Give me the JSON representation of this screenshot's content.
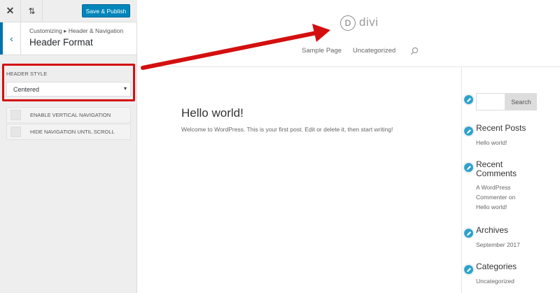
{
  "customizer": {
    "publish_label": "Save & Publish",
    "close_icon": "✕",
    "preview_icon": "⇅",
    "back_icon": "‹",
    "breadcrumb": "Customizing ▸ Header & Navigation",
    "section_title": "Header Format",
    "header_style_label": "HEADER STYLE",
    "header_style_value": "Centered",
    "caret": "▾",
    "toggles": [
      {
        "label": "ENABLE VERTICAL NAVIGATION"
      },
      {
        "label": "HIDE NAVIGATION UNTIL SCROLL"
      }
    ]
  },
  "site": {
    "logo_letter": "D",
    "logo_text": "divi",
    "nav": [
      "Sample Page",
      "Uncategorized"
    ],
    "post_title": "Hello world!",
    "post_excerpt": "Welcome to WordPress. This is your first post. Edit or delete it, then start writing!"
  },
  "widgets": {
    "search_button": "Search",
    "recent_posts_title": "Recent Posts",
    "recent_posts": [
      "Hello world!"
    ],
    "recent_comments_title_line1": "Recent",
    "recent_comments_title_line2": "Comments",
    "recent_comments_lines": [
      "A WordPress",
      "Commenter on",
      "Hello world!"
    ],
    "archives_title": "Archives",
    "archives": [
      "September 2017"
    ],
    "categories_title": "Categories",
    "categories": [
      "Uncategorized"
    ]
  },
  "colors": {
    "accent": "#0085ba",
    "highlight": "#d40f0f",
    "edit_icon": "#2ea2cc"
  }
}
